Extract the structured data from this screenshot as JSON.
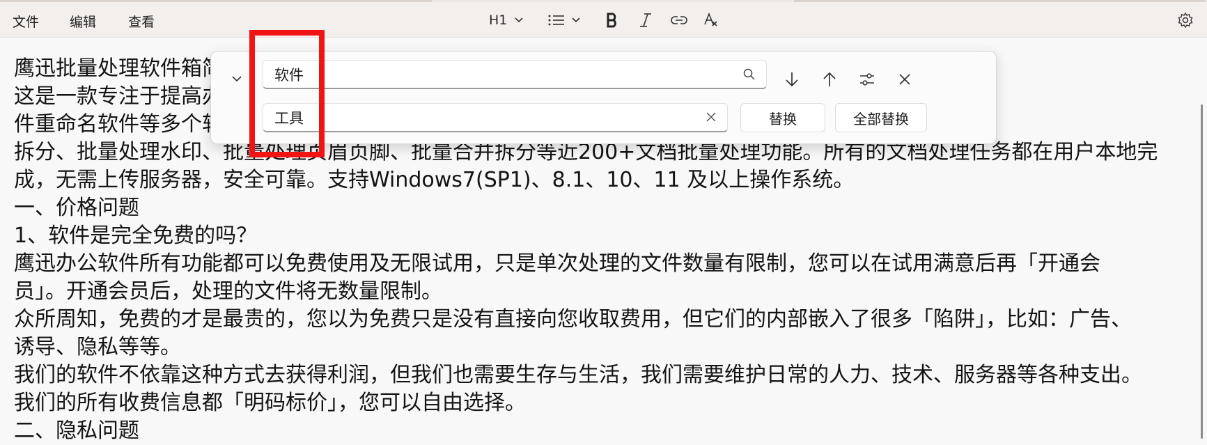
{
  "menubar": {
    "menus": [
      "文件",
      "编辑",
      "查看"
    ],
    "heading_label": "H1"
  },
  "toolbar_icons": [
    "heading-dropdown",
    "list-icon",
    "bold-icon",
    "italic-icon",
    "link-icon",
    "clear-format-icon",
    "settings-icon"
  ],
  "editor": {
    "lines": [
      "鹰迅批量处理软件箱简介",
      "这是一款专注于提高办公效率的软件，包含PDF处理软件、Office处理软件、图片处理软件、文",
      "件重命名软件等多个软件，支持格式转换、批量压缩、批量水印、批量文件重命名、批量合并",
      "拆分、批量处理水印、批量处理页眉页脚、批量合并拆分等近200+文档批量处理功能。所有的文档处理任务都在用户本地完",
      "成，无需上传服务器，安全可靠。支持Windows7(SP1)、8.1、10、11 及以上操作系统。",
      "一、价格问题",
      "1、软件是完全免费的吗？",
      "鹰迅办公软件所有功能都可以免费使用及无限试用，只是单次处理的文件数量有限制，您可以在试用满意后再「开通会",
      "员」。开通会员后，处理的文件将无数量限制。",
      "众所周知，免费的才是最贵的，您以为免费只是没有直接向您收取费用，但它们的内部嵌入了很多「陷阱」，比如：广告、",
      "诱导、隐私等等。",
      "我们的软件不依靠这种方式去获得利润，但我们也需要生存与生活，我们需要维护日常的人力、技术、服务器等各种支出。",
      "我们的所有收费信息都「明码标价」，您可以自由选择。",
      "二、隐私问题"
    ]
  },
  "find_replace": {
    "find_value": "软件",
    "replace_value": "工具",
    "replace_button": "替换",
    "replace_all_button": "全部替换"
  },
  "colors": {
    "highlight": "#f01414",
    "menubar_bg": "#f3efed",
    "editor_bg": "#f9f8f8"
  }
}
